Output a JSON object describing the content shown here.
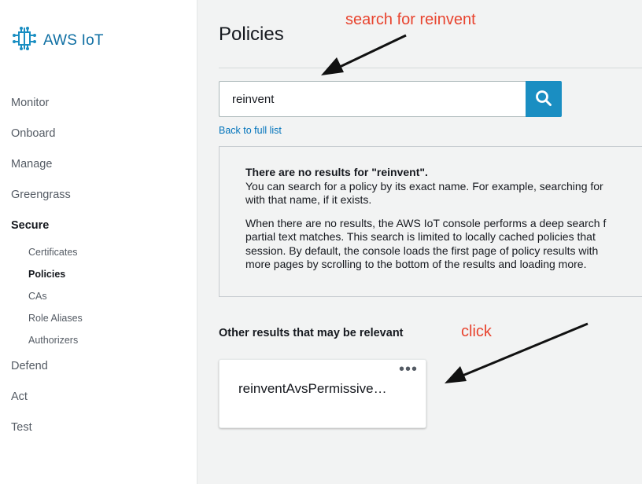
{
  "app": {
    "brand_name": "AWS IoT"
  },
  "sidebar": {
    "items": [
      {
        "label": "Monitor"
      },
      {
        "label": "Onboard"
      },
      {
        "label": "Manage"
      },
      {
        "label": "Greengrass"
      },
      {
        "label": "Secure",
        "active": true
      },
      {
        "label": "Defend"
      },
      {
        "label": "Act"
      },
      {
        "label": "Test"
      }
    ],
    "secure_sub": [
      {
        "label": "Certificates"
      },
      {
        "label": "Policies",
        "active": true
      },
      {
        "label": "CAs"
      },
      {
        "label": "Role Aliases"
      },
      {
        "label": "Authorizers"
      }
    ]
  },
  "main": {
    "title": "Policies",
    "search": {
      "value": "reinvent",
      "icon": "search-icon"
    },
    "back_link": "Back to full list",
    "no_results": {
      "heading": "There are no results for \"reinvent\".",
      "p1_line1": "You can search for a policy by its exact name. For example, searching for",
      "p1_line2": "with that name, if it exists.",
      "p2_line1": "When there are no results, the AWS IoT console performs a deep search f",
      "p2_line2": "partial text matches. This search is limited to locally cached policies that",
      "p2_line3": "session. By default, the console loads the first page of policy results with",
      "p2_line4": "more pages by scrolling to the bottom of the results and loading more."
    },
    "other_results_title": "Other results that may be relevant",
    "cards": [
      {
        "name": "reinventAvsPermissive…",
        "menu": "•••"
      }
    ]
  },
  "annotations": {
    "search_note": "search for reinvent",
    "click_note": "click",
    "color": "#e8432e"
  }
}
